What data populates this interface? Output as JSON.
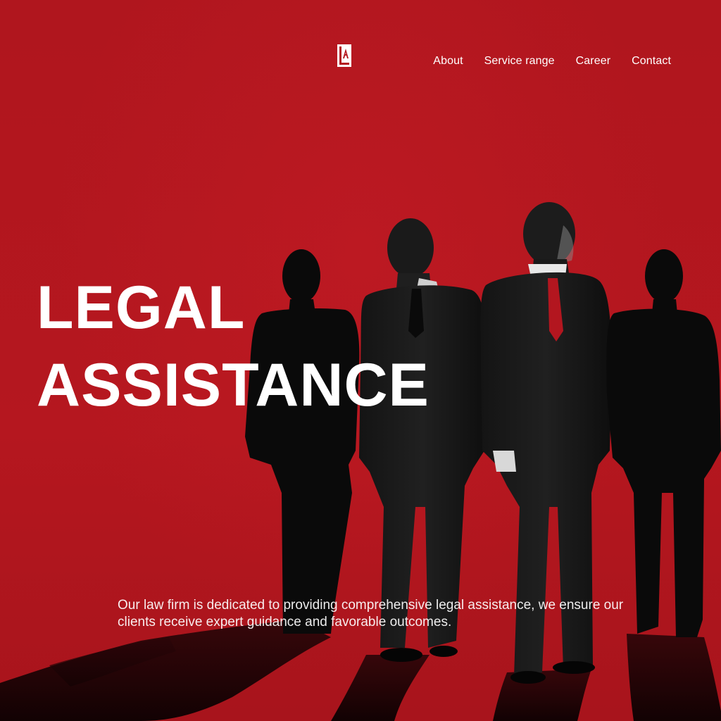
{
  "brand": {
    "logo_icon": "law-firm-logo-icon",
    "logo_text": "LA"
  },
  "nav": {
    "items": [
      {
        "label": "About"
      },
      {
        "label": "Service range"
      },
      {
        "label": "Career"
      },
      {
        "label": "Contact"
      }
    ]
  },
  "hero": {
    "title_line_1": "LEGAL",
    "title_line_2": "ASSISTANCE",
    "description": "Our law firm is dedicated to providing comprehensive legal assistance, we ensure our clients receive expert guidance and favorable outcomes.",
    "image_subject": "four-men-in-suits-silhouette"
  },
  "colors": {
    "background": "#b3161f",
    "text": "#ffffff",
    "silhouette": "#0b0b0b",
    "tie": "#b3161f"
  }
}
